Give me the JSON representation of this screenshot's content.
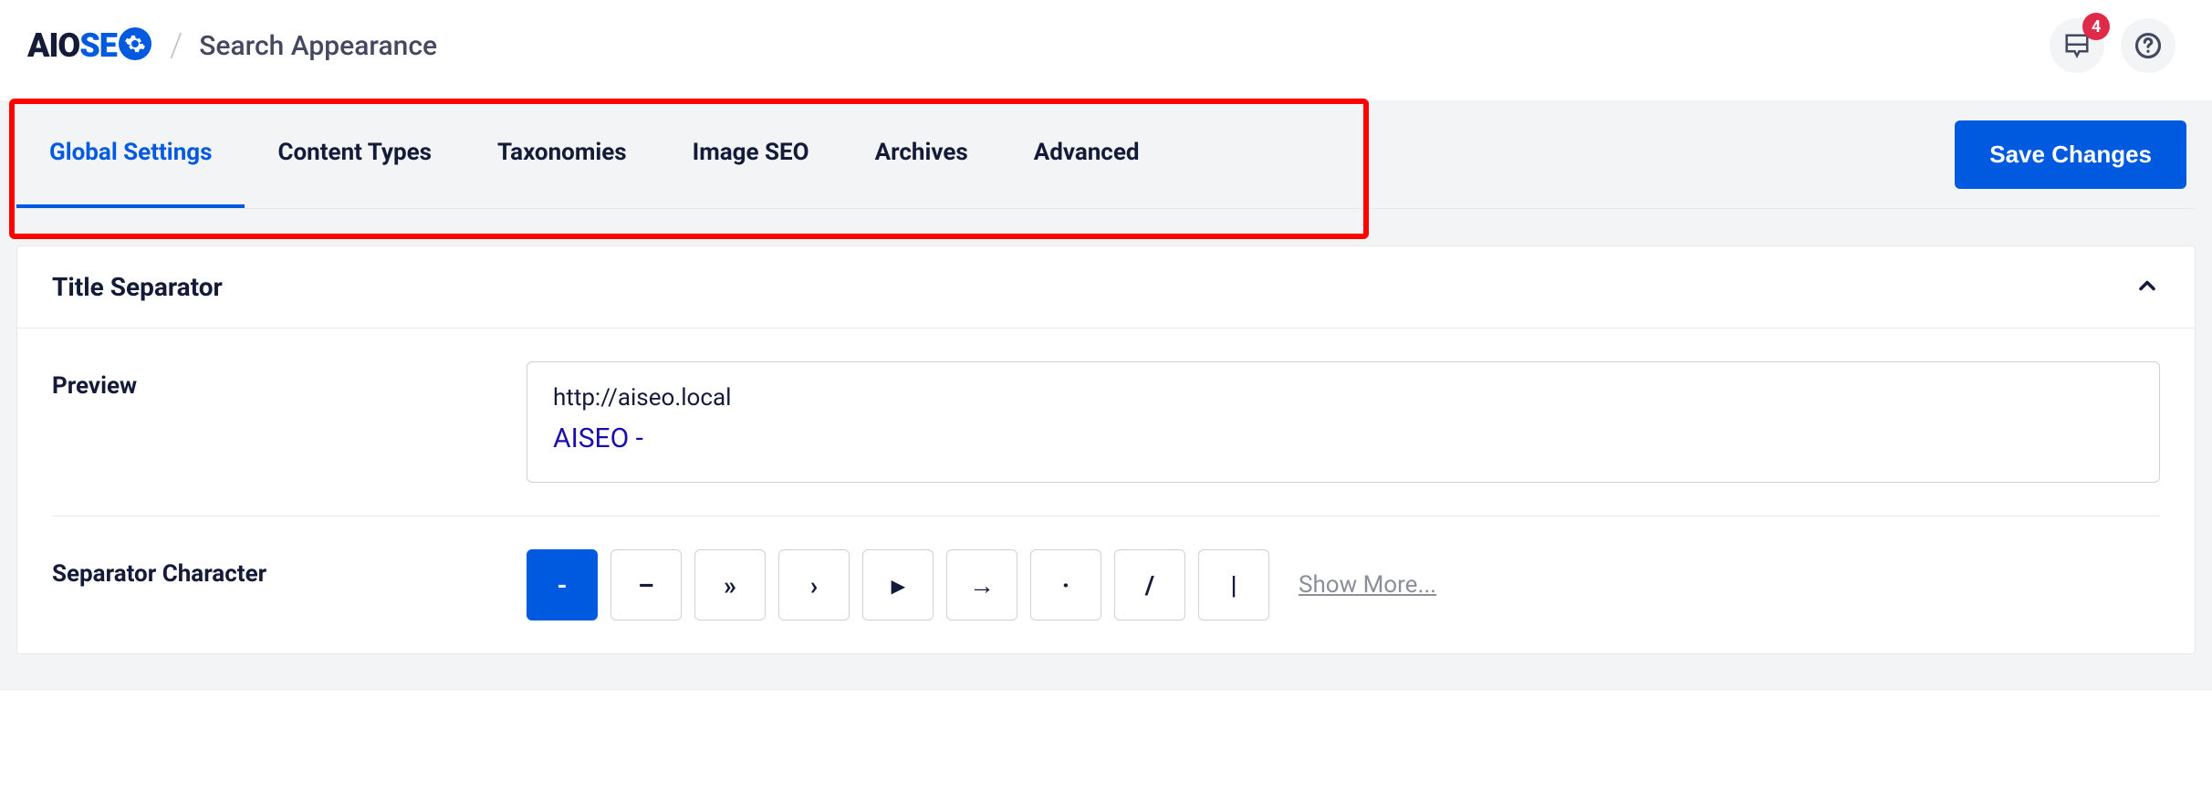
{
  "header": {
    "logo_aio": "AIO",
    "logo_se": "SE",
    "crumb_sep": "/",
    "page_title": "Search Appearance",
    "notification_count": "4"
  },
  "tabs": {
    "items": [
      {
        "label": "Global Settings",
        "active": true
      },
      {
        "label": "Content Types",
        "active": false
      },
      {
        "label": "Taxonomies",
        "active": false
      },
      {
        "label": "Image SEO",
        "active": false
      },
      {
        "label": "Archives",
        "active": false
      },
      {
        "label": "Advanced",
        "active": false
      }
    ],
    "save_label": "Save Changes"
  },
  "card": {
    "title": "Title Separator",
    "preview": {
      "label": "Preview",
      "url": "http://aiseo.local",
      "title": "AISEO -"
    },
    "separator": {
      "label": "Separator Character",
      "options": [
        "-",
        "–",
        "»",
        "›",
        "▸",
        "→",
        "·",
        "/",
        "|"
      ],
      "active_index": 0,
      "show_more": "Show More..."
    }
  }
}
